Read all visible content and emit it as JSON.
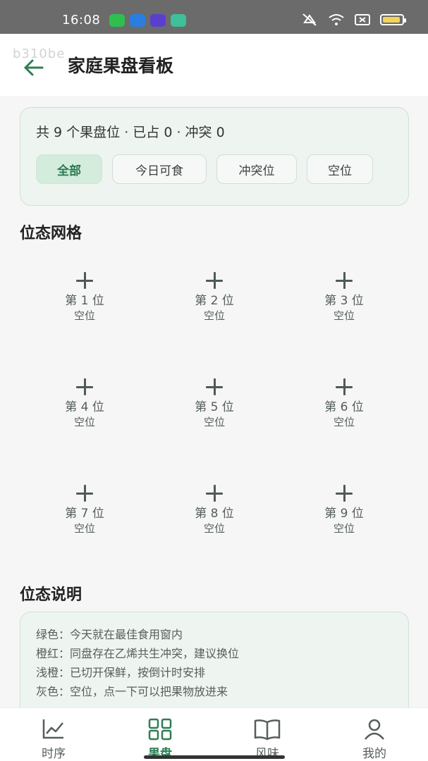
{
  "status_bar": {
    "time": "16:08",
    "notifications": [
      {
        "icon": "chat-app-icon",
        "color": "#2fbf4f"
      },
      {
        "icon": "browser-app-icon",
        "color": "#2b7de0"
      },
      {
        "icon": "cloud-app-icon",
        "color": "#5a3fcf"
      },
      {
        "icon": "location-app-icon",
        "color": "#3fbf9a"
      }
    ],
    "right_icons": [
      "mute-icon",
      "wifi-icon",
      "sim-icon",
      "battery-icon"
    ]
  },
  "header": {
    "watermark": "b310be",
    "back_icon": "arrow-left-icon",
    "title": "家庭果盘看板"
  },
  "summary_card": {
    "summary_text": "共 9 个果盘位 · 已占 0 · 冲突 0",
    "filters": [
      {
        "label": "全部",
        "active": true
      },
      {
        "label": "今日可食",
        "active": false
      },
      {
        "label": "冲突位",
        "active": false
      },
      {
        "label": "空位",
        "active": false
      }
    ]
  },
  "grid_section": {
    "title": "位态网格",
    "slots": [
      {
        "name": "第 1 位",
        "state": "空位"
      },
      {
        "name": "第 2 位",
        "state": "空位"
      },
      {
        "name": "第 3 位",
        "state": "空位"
      },
      {
        "name": "第 4 位",
        "state": "空位"
      },
      {
        "name": "第 5 位",
        "state": "空位"
      },
      {
        "name": "第 6 位",
        "state": "空位"
      },
      {
        "name": "第 7 位",
        "state": "空位"
      },
      {
        "name": "第 8 位",
        "state": "空位"
      },
      {
        "name": "第 9 位",
        "state": "空位"
      }
    ]
  },
  "legend_section": {
    "title": "位态说明",
    "lines": [
      "绿色：今天就在最佳食用窗内",
      "橙红：同盘存在乙烯共生冲突，建议换位",
      "浅橙：已切开保鲜，按倒计时安排",
      "灰色：空位，点一下可以把果物放进来"
    ]
  },
  "bottom_nav": {
    "items": [
      {
        "label": "时序",
        "icon": "chart-line-icon",
        "active": false
      },
      {
        "label": "果盘",
        "icon": "grid-icon",
        "active": true
      },
      {
        "label": "风味",
        "icon": "book-icon",
        "active": false
      },
      {
        "label": "我的",
        "icon": "person-icon",
        "active": false
      }
    ]
  },
  "colors": {
    "accent": "#2f7d55",
    "card_bg": "#eef5f1",
    "active_chip_bg": "#d3ecdc"
  }
}
